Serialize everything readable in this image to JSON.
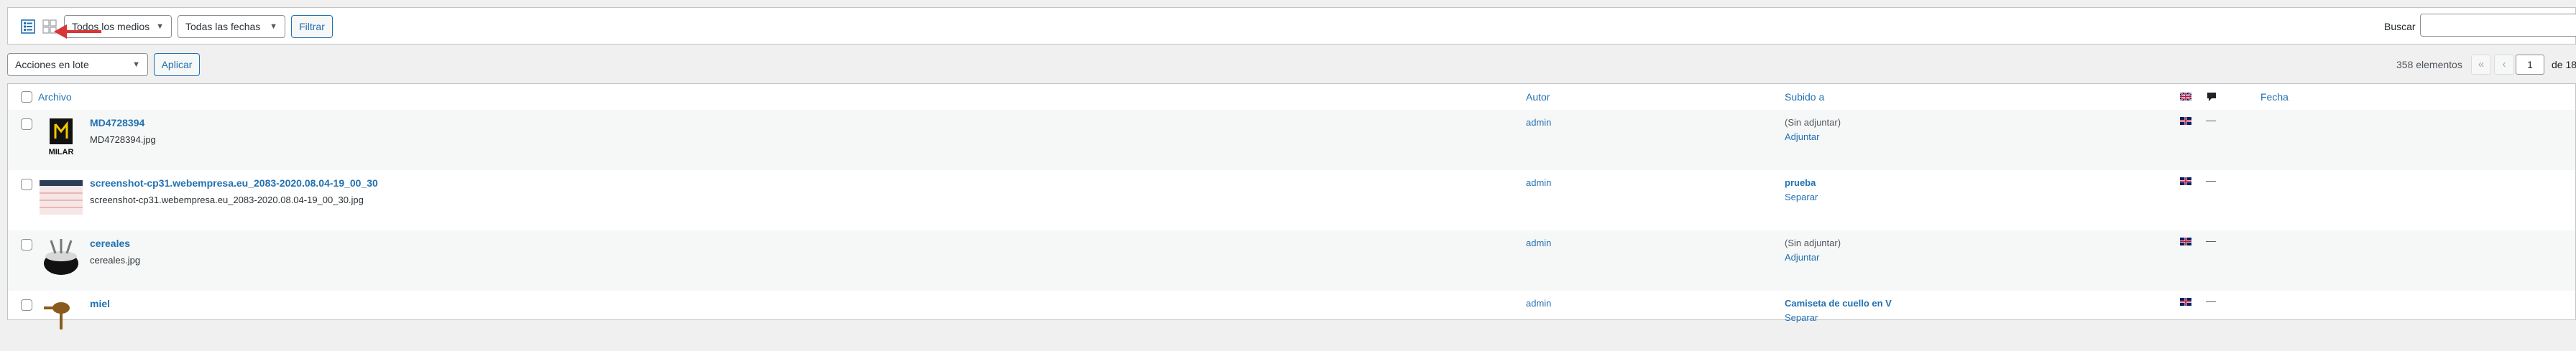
{
  "filters": {
    "media_type_select": "Todos los medios",
    "date_select": "Todas las fechas",
    "filter_button": "Filtrar",
    "search_label": "Buscar",
    "search_value": ""
  },
  "bulk": {
    "select": "Acciones en lote",
    "apply_button": "Aplicar"
  },
  "pagination": {
    "count": "358 elementos",
    "first": "«",
    "prev": "‹",
    "current_page": "1",
    "of_total": "de 18"
  },
  "table": {
    "columns": {
      "file": "Archivo",
      "author": "Autor",
      "uploaded_to": "Subido a",
      "date": "Fecha"
    },
    "rows": [
      {
        "title": "MD4728394",
        "filename": "MD4728394.jpg",
        "author": "admin",
        "parent": "(Sin adjuntar)",
        "action": "Adjuntar",
        "translation": "—",
        "thumb_text": "MILAR"
      },
      {
        "title": "screenshot-cp31.webempresa.eu_2083-2020.08.04-19_00_30",
        "filename": "screenshot-cp31.webempresa.eu_2083-2020.08.04-19_00_30.jpg",
        "author": "admin",
        "parent": "prueba",
        "action": "Separar",
        "translation": "—"
      },
      {
        "title": "cereales",
        "filename": "cereales.jpg",
        "author": "admin",
        "parent": "(Sin adjuntar)",
        "action": "Adjuntar",
        "translation": "—"
      },
      {
        "title": "miel",
        "filename": "",
        "author": "admin",
        "parent": "Camiseta de cuello en V",
        "action": "Separar",
        "translation": "—"
      }
    ]
  },
  "icons": {
    "list_view": "list-view-icon",
    "grid_view": "grid-view-icon",
    "annotation_arrow": "red-arrow-icon",
    "language_flag": "uk-flag-icon",
    "comment": "comment-bubble-icon"
  },
  "colors": {
    "link": "#2271b1",
    "arrow": "#d63638",
    "background": "#f0f0f1"
  }
}
